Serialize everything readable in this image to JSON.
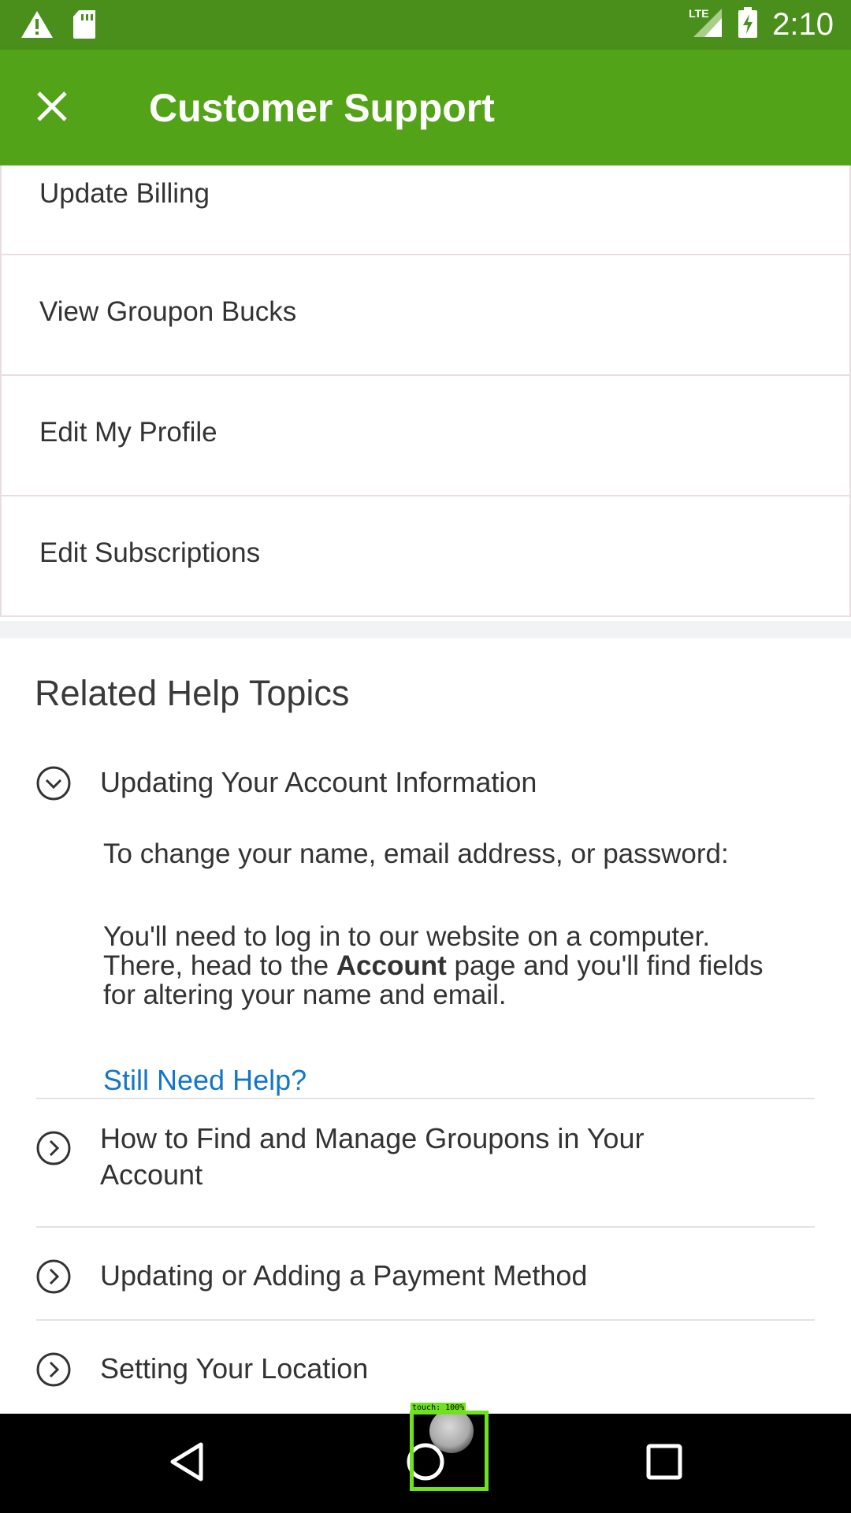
{
  "status_bar": {
    "time": "2:10",
    "network": "LTE",
    "icons": [
      "warning-icon",
      "sd-card-icon",
      "signal-icon",
      "battery-charging-icon"
    ]
  },
  "app_bar": {
    "title": "Customer Support",
    "close_icon": "close-icon"
  },
  "menu": {
    "items": [
      {
        "label": "Update Billing"
      },
      {
        "label": "View Groupon Bucks"
      },
      {
        "label": "Edit My Profile"
      },
      {
        "label": "Edit Subscriptions"
      }
    ]
  },
  "related": {
    "heading": "Related Help Topics",
    "expanded_topic": {
      "title": "Updating Your Account Information",
      "question": "To change your name, email address, or password:",
      "answer_part1": "You'll need to log in to our website on a computer. There, head to the ",
      "answer_bold": "Account",
      "answer_part2": " page and you'll find fields for altering your name and email.",
      "help_link": "Still Need Help?"
    },
    "topics": [
      {
        "title": "How to Find and Manage Groupons in Your Account"
      },
      {
        "title": "Updating or Adding a Payment Method"
      },
      {
        "title": "Setting Your Location"
      }
    ]
  },
  "nav_bar": {
    "buttons": [
      "back-icon",
      "home-icon",
      "recents-icon"
    ]
  },
  "overlay": {
    "touch_label": "touch: 100%"
  },
  "colors": {
    "status_bar": "#4a8f1c",
    "app_bar": "#53a318",
    "link": "#1476c6",
    "touch_highlight": "#6fe21c"
  }
}
